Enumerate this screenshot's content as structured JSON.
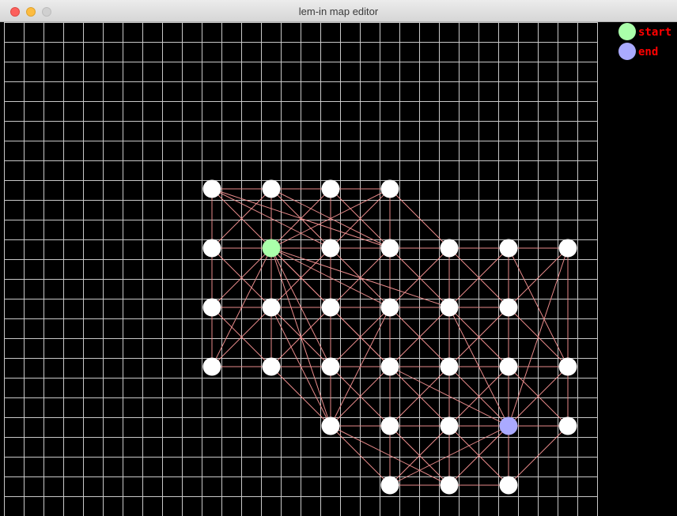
{
  "window": {
    "title": "lem-in map editor"
  },
  "legend": {
    "start": {
      "label": "start",
      "color": "#aaffaa"
    },
    "end": {
      "label": "end",
      "color": "#aaaaff"
    },
    "label_color": "#ff0000"
  },
  "colors": {
    "grid": "#c8c8c8",
    "room": "#ffffff",
    "link": "#e88a8a",
    "background": "#000000"
  },
  "map": {
    "rooms": [
      {
        "col": 10,
        "row": 8
      },
      {
        "col": 13,
        "row": 8
      },
      {
        "col": 16,
        "row": 8
      },
      {
        "col": 19,
        "row": 8
      },
      {
        "col": 10,
        "row": 11
      },
      {
        "col": 13,
        "row": 11,
        "type": "start"
      },
      {
        "col": 16,
        "row": 11
      },
      {
        "col": 19,
        "row": 11
      },
      {
        "col": 22,
        "row": 11
      },
      {
        "col": 25,
        "row": 11
      },
      {
        "col": 28,
        "row": 11
      },
      {
        "col": 10,
        "row": 14
      },
      {
        "col": 13,
        "row": 14
      },
      {
        "col": 16,
        "row": 14
      },
      {
        "col": 19,
        "row": 14
      },
      {
        "col": 22,
        "row": 14
      },
      {
        "col": 25,
        "row": 14
      },
      {
        "col": 10,
        "row": 17
      },
      {
        "col": 13,
        "row": 17
      },
      {
        "col": 16,
        "row": 17
      },
      {
        "col": 19,
        "row": 17
      },
      {
        "col": 22,
        "row": 17
      },
      {
        "col": 25,
        "row": 17
      },
      {
        "col": 28,
        "row": 17
      },
      {
        "col": 16,
        "row": 20
      },
      {
        "col": 19,
        "row": 20
      },
      {
        "col": 22,
        "row": 20
      },
      {
        "col": 25,
        "row": 20,
        "type": "end"
      },
      {
        "col": 28,
        "row": 20
      },
      {
        "col": 19,
        "row": 23
      },
      {
        "col": 22,
        "row": 23
      },
      {
        "col": 25,
        "row": 23
      }
    ],
    "links": [
      [
        10,
        8,
        13,
        8
      ],
      [
        13,
        8,
        16,
        8
      ],
      [
        16,
        8,
        19,
        8
      ],
      [
        10,
        8,
        10,
        11
      ],
      [
        13,
        8,
        13,
        11
      ],
      [
        16,
        8,
        16,
        11
      ],
      [
        19,
        8,
        19,
        11
      ],
      [
        10,
        8,
        13,
        11
      ],
      [
        10,
        8,
        16,
        11
      ],
      [
        10,
        8,
        19,
        11
      ],
      [
        13,
        8,
        10,
        11
      ],
      [
        13,
        8,
        16,
        11
      ],
      [
        13,
        8,
        19,
        11
      ],
      [
        16,
        8,
        13,
        11
      ],
      [
        16,
        8,
        19,
        11
      ],
      [
        19,
        8,
        13,
        11
      ],
      [
        19,
        8,
        16,
        11
      ],
      [
        19,
        8,
        22,
        11
      ],
      [
        10,
        11,
        13,
        11
      ],
      [
        13,
        11,
        16,
        11
      ],
      [
        16,
        11,
        19,
        11
      ],
      [
        19,
        11,
        22,
        11
      ],
      [
        22,
        11,
        25,
        11
      ],
      [
        25,
        11,
        28,
        11
      ],
      [
        10,
        11,
        10,
        14
      ],
      [
        13,
        11,
        13,
        14
      ],
      [
        16,
        11,
        16,
        14
      ],
      [
        19,
        11,
        19,
        14
      ],
      [
        22,
        11,
        22,
        14
      ],
      [
        25,
        11,
        25,
        14
      ],
      [
        10,
        11,
        13,
        14
      ],
      [
        13,
        11,
        10,
        14
      ],
      [
        13,
        11,
        16,
        14
      ],
      [
        13,
        11,
        19,
        14
      ],
      [
        13,
        11,
        22,
        14
      ],
      [
        16,
        11,
        13,
        14
      ],
      [
        16,
        11,
        19,
        14
      ],
      [
        19,
        11,
        16,
        14
      ],
      [
        19,
        11,
        22,
        14
      ],
      [
        22,
        11,
        19,
        14
      ],
      [
        22,
        11,
        25,
        14
      ],
      [
        25,
        11,
        22,
        14
      ],
      [
        25,
        11,
        28,
        17
      ],
      [
        28,
        11,
        25,
        14
      ],
      [
        28,
        11,
        28,
        17
      ],
      [
        28,
        11,
        25,
        20
      ],
      [
        13,
        11,
        10,
        17
      ],
      [
        13,
        11,
        16,
        17
      ],
      [
        13,
        11,
        19,
        17
      ],
      [
        13,
        11,
        16,
        20
      ],
      [
        10,
        14,
        13,
        14
      ],
      [
        13,
        14,
        16,
        14
      ],
      [
        16,
        14,
        19,
        14
      ],
      [
        19,
        14,
        22,
        14
      ],
      [
        22,
        14,
        25,
        14
      ],
      [
        10,
        14,
        10,
        17
      ],
      [
        13,
        14,
        13,
        17
      ],
      [
        16,
        14,
        16,
        17
      ],
      [
        19,
        14,
        19,
        17
      ],
      [
        22,
        14,
        22,
        17
      ],
      [
        25,
        14,
        25,
        17
      ],
      [
        10,
        14,
        13,
        17
      ],
      [
        13,
        14,
        10,
        17
      ],
      [
        13,
        14,
        16,
        17
      ],
      [
        16,
        14,
        13,
        17
      ],
      [
        16,
        14,
        19,
        17
      ],
      [
        19,
        14,
        16,
        17
      ],
      [
        19,
        14,
        22,
        17
      ],
      [
        22,
        14,
        19,
        17
      ],
      [
        22,
        14,
        25,
        17
      ],
      [
        25,
        14,
        22,
        17
      ],
      [
        25,
        14,
        28,
        17
      ],
      [
        13,
        14,
        16,
        20
      ],
      [
        19,
        14,
        16,
        20
      ],
      [
        22,
        14,
        25,
        20
      ],
      [
        10,
        17,
        13,
        17
      ],
      [
        13,
        17,
        16,
        17
      ],
      [
        16,
        17,
        19,
        17
      ],
      [
        19,
        17,
        22,
        17
      ],
      [
        22,
        17,
        25,
        17
      ],
      [
        25,
        17,
        28,
        17
      ],
      [
        16,
        17,
        16,
        20
      ],
      [
        19,
        17,
        19,
        20
      ],
      [
        22,
        17,
        22,
        20
      ],
      [
        25,
        17,
        25,
        20
      ],
      [
        28,
        17,
        28,
        20
      ],
      [
        13,
        17,
        16,
        20
      ],
      [
        16,
        17,
        19,
        20
      ],
      [
        19,
        17,
        16,
        20
      ],
      [
        19,
        17,
        22,
        20
      ],
      [
        19,
        17,
        25,
        20
      ],
      [
        22,
        17,
        19,
        20
      ],
      [
        22,
        17,
        25,
        20
      ],
      [
        25,
        17,
        22,
        20
      ],
      [
        25,
        17,
        28,
        20
      ],
      [
        28,
        17,
        25,
        20
      ],
      [
        16,
        20,
        19,
        20
      ],
      [
        19,
        20,
        22,
        20
      ],
      [
        22,
        20,
        25,
        20
      ],
      [
        25,
        20,
        28,
        20
      ],
      [
        16,
        20,
        19,
        23
      ],
      [
        16,
        20,
        22,
        23
      ],
      [
        19,
        20,
        19,
        23
      ],
      [
        19,
        20,
        22,
        23
      ],
      [
        22,
        20,
        19,
        23
      ],
      [
        22,
        20,
        22,
        23
      ],
      [
        22,
        20,
        25,
        23
      ],
      [
        25,
        20,
        19,
        23
      ],
      [
        25,
        20,
        22,
        23
      ],
      [
        25,
        20,
        25,
        23
      ],
      [
        28,
        20,
        25,
        23
      ],
      [
        19,
        23,
        22,
        23
      ],
      [
        22,
        23,
        25,
        23
      ]
    ]
  }
}
